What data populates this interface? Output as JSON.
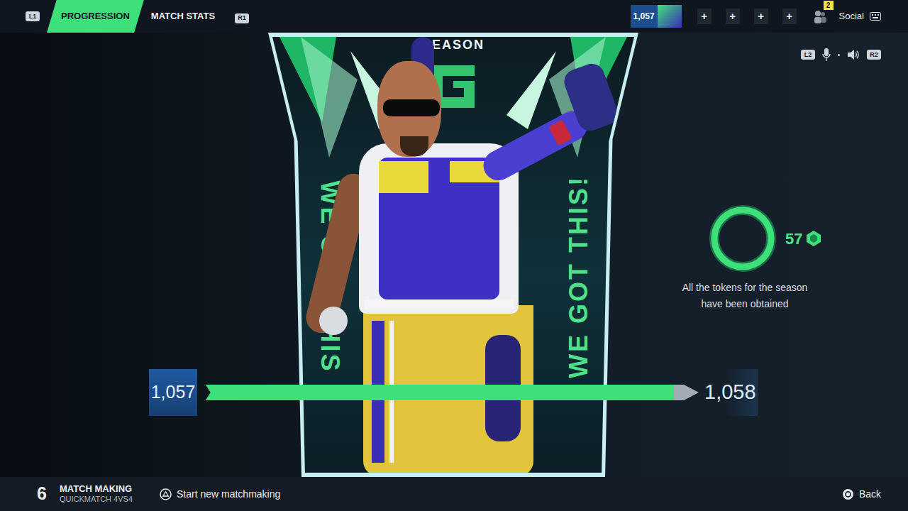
{
  "tabs": {
    "left_key": "L1",
    "right_key": "R1",
    "items": [
      {
        "label": "PROGRESSION",
        "selected": true
      },
      {
        "label": "MATCH STATS",
        "selected": false
      }
    ]
  },
  "header": {
    "level": "1,057",
    "party_slots": [
      "+",
      "+",
      "+",
      "+"
    ],
    "party_count": "2",
    "social": "Social"
  },
  "voice": {
    "left_key": "L2",
    "right_key": "R2"
  },
  "card": {
    "title": "SEASON",
    "side_text_left": "WE GOT THIS",
    "side_text_right": "WE GOT THIS!"
  },
  "progress": {
    "current_level": "1,057",
    "next_level": "1,058",
    "level": 0.95
  },
  "tokens": {
    "count": "57",
    "level": 1,
    "message": "All the tokens for the season have been obtained"
  },
  "footer": {
    "count": "6",
    "mode_title": "MATCH MAKING",
    "mode_subtitle": "QUICKMATCH 4VS4",
    "actions": [
      {
        "button": "triangle",
        "label": "Start new matchmaking"
      },
      {
        "button": "circle",
        "label": "Back"
      }
    ]
  }
}
